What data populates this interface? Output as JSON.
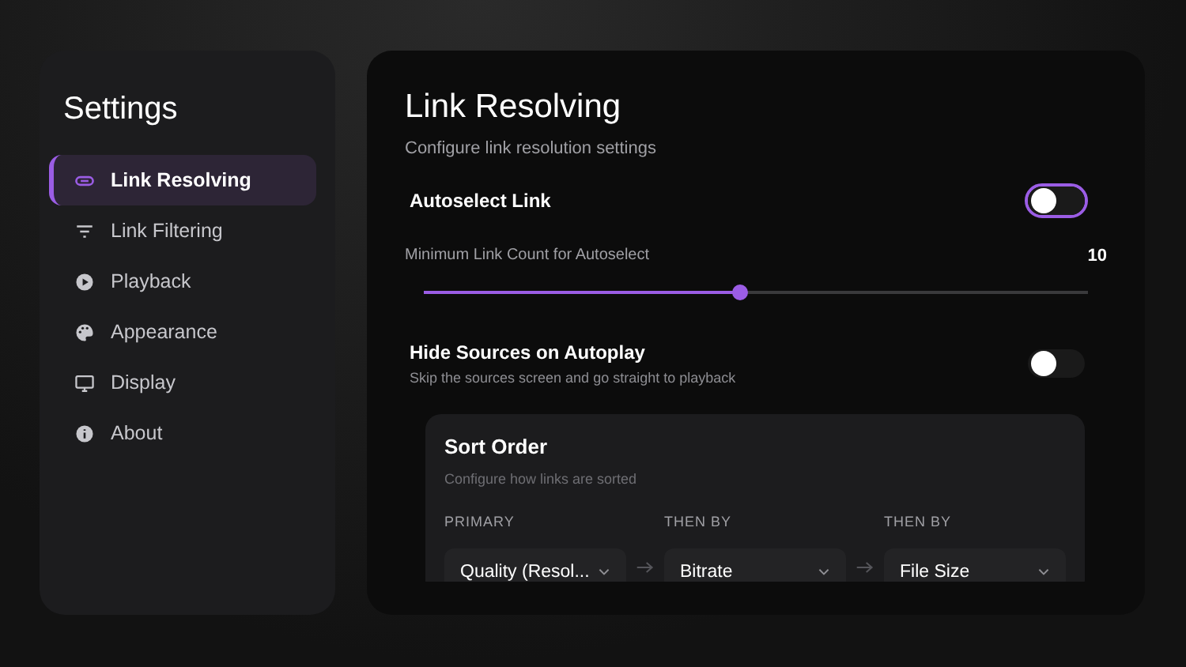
{
  "sidebar": {
    "title": "Settings",
    "items": [
      {
        "label": "Link Resolving",
        "selected": true
      },
      {
        "label": "Link Filtering",
        "selected": false
      },
      {
        "label": "Playback",
        "selected": false
      },
      {
        "label": "Appearance",
        "selected": false
      },
      {
        "label": "Display",
        "selected": false
      },
      {
        "label": "About",
        "selected": false
      }
    ]
  },
  "main": {
    "title": "Link Resolving",
    "subtitle": "Configure link resolution settings",
    "settings": [
      {
        "kind": "toggle",
        "label": "Autoselect Link",
        "on": false,
        "selected": true
      },
      {
        "kind": "slider",
        "label": "Minimum Link Count for Autoselect",
        "reading": "10",
        "level": 0.475,
        "selected": false
      },
      {
        "kind": "toggle",
        "label": "Hide Sources on Autoplay",
        "description": "Skip the sources screen and go straight to playback",
        "on": false,
        "selected": false
      }
    ],
    "sort_order": {
      "title": "Sort Order",
      "subtitle": "Configure how links are sorted",
      "fields": [
        {
          "label": "PRIMARY",
          "value": "Quality (Resol..."
        },
        {
          "label": "THEN BY",
          "value": "Bitrate"
        },
        {
          "label": "THEN BY",
          "value": "File Size"
        }
      ]
    }
  }
}
